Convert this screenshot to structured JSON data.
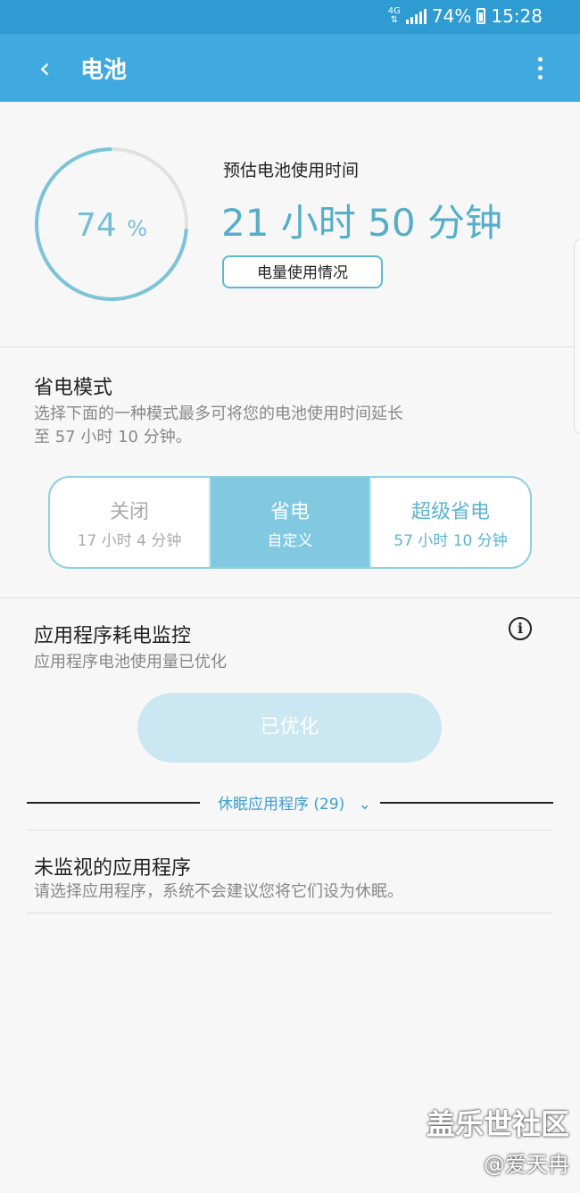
{
  "status": {
    "network": "4G",
    "battery_pct": "74%",
    "time": "15:28"
  },
  "header": {
    "title": "电池"
  },
  "battery": {
    "level_pct": 74,
    "level_number": "74",
    "level_unit": "%",
    "estimate_label": "预估电池使用时间",
    "estimate_value": "21 小时 50 分钟",
    "usage_button": "电量使用情况"
  },
  "power_saving": {
    "title": "省电模式",
    "desc_line1": "选择下面的一种模式最多可将您的电池使用时间延长",
    "desc_line2": "至 57 小时 10 分钟。",
    "modes": [
      {
        "name": "关闭",
        "sub": "17 小时 4 分钟"
      },
      {
        "name": "省电",
        "sub": "自定义"
      },
      {
        "name": "超级省电",
        "sub": "57 小时 10 分钟"
      }
    ]
  },
  "app_monitor": {
    "title": "应用程序耗电监控",
    "desc": "应用程序电池使用量已优化",
    "button": "已优化",
    "sleeping_label": "休眠应用程序 (29)"
  },
  "unmonitored": {
    "title": "未监视的应用程序",
    "desc": "请选择应用程序，系统不会建议您将它们设为休眠。"
  },
  "watermark": {
    "line1": "盖乐世社区",
    "line2": "@爱天冉"
  },
  "colors": {
    "appbar": "#3fa9e0",
    "statusbar": "#2f9bd3",
    "accent": "#55aec8",
    "ring": "#7cc4d8",
    "active_mode": "#81c9e1"
  }
}
